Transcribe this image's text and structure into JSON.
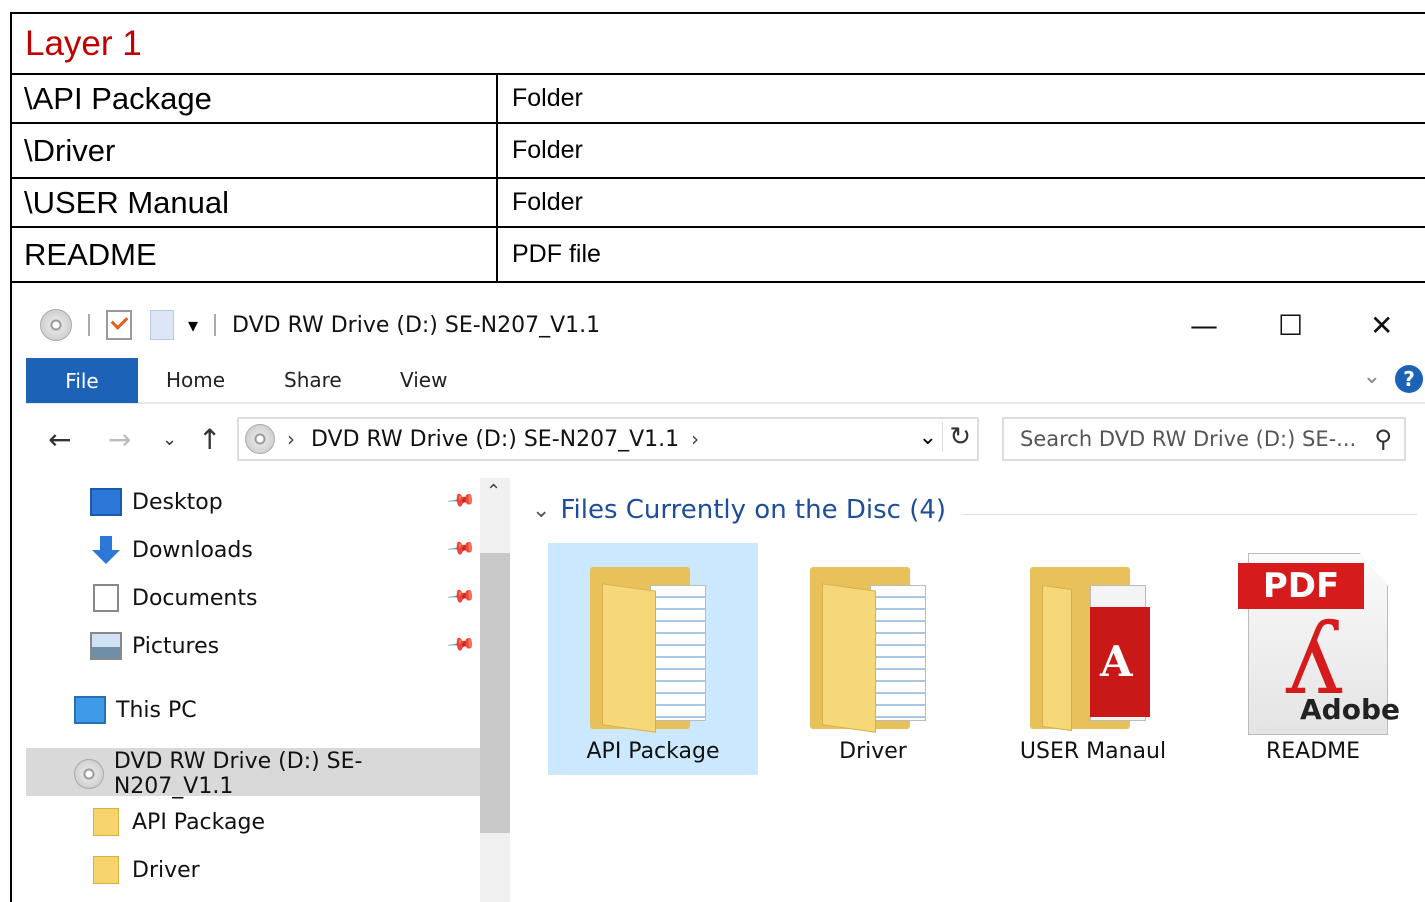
{
  "document": {
    "layer_title": "Layer 1",
    "rows": [
      {
        "name": "\\API Package",
        "type": "Folder"
      },
      {
        "name": "\\Driver",
        "type": "Folder"
      },
      {
        "name": "\\USER Manual",
        "type": "Folder"
      },
      {
        "name": "README",
        "type": "PDF file"
      }
    ]
  },
  "explorer": {
    "window_title": "DVD RW Drive (D:) SE-N207_V1.1",
    "controls": {
      "minimize": "—",
      "maximize": "☐",
      "close": "✕"
    },
    "ribbon_tabs": {
      "file": "File",
      "home": "Home",
      "share": "Share",
      "view": "View"
    },
    "address": {
      "path": "DVD RW Drive (D:) SE-N207_V1.1"
    },
    "search": {
      "placeholder": "Search DVD RW Drive (D:) SE-..."
    },
    "sidebar": {
      "quick_access": [
        {
          "label": "Desktop",
          "icon": "desktop-icon"
        },
        {
          "label": "Downloads",
          "icon": "downloads-icon"
        },
        {
          "label": "Documents",
          "icon": "documents-icon"
        },
        {
          "label": "Pictures",
          "icon": "pictures-icon"
        }
      ],
      "this_pc": "This PC",
      "drive": "DVD RW Drive (D:) SE-N207_V1.1",
      "children": [
        "API Package",
        "Driver"
      ]
    },
    "content": {
      "group_title": "Files Currently on the Disc (4)",
      "items": [
        {
          "label": "API Package",
          "icon": "folder-icon",
          "selected": true
        },
        {
          "label": "Driver",
          "icon": "folder-icon",
          "selected": false
        },
        {
          "label": "USER Manaul",
          "icon": "pdf-folder-icon",
          "selected": false
        },
        {
          "label": "README",
          "icon": "pdf-file-icon",
          "selected": false
        }
      ],
      "pdf_badge": "PDF",
      "adobe_text": "Adobe",
      "pdf_folder_letter": "A"
    },
    "accent_color": "#1c63b8"
  }
}
